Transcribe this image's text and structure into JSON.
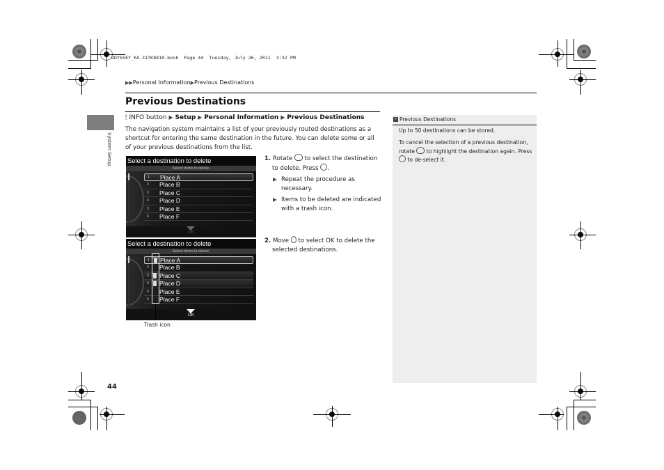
{
  "file_header": "ODYSSEY_KA-31TK8810.book  Page 44  Tuesday, July 26, 2011  3:32 PM",
  "breadcrumb": {
    "arrow": "▶▶",
    "items": [
      "Personal Information",
      "Previous Destinations"
    ],
    "separator": "▶"
  },
  "side_tab": {
    "label": "System Setup"
  },
  "page_title": "Previous Destinations",
  "path": {
    "icon": "info-button-icon",
    "start": "INFO button",
    "separator": "▶",
    "steps": [
      "Setup",
      "Personal Information",
      "Previous Destinations"
    ]
  },
  "intro": "The navigation system maintains a list of your previously routed destinations as a shortcut for entering the same destination in the future. You can delete some or all of your previous destinations from the list.",
  "screens": [
    {
      "title": "Select a destination to delete",
      "subtitle": "Select items to delete.",
      "ok_label": "OK",
      "rows": [
        {
          "num": "1",
          "label": "Place A",
          "selected": true,
          "trash": false
        },
        {
          "num": "2",
          "label": "Place B",
          "selected": false,
          "trash": false
        },
        {
          "num": "3",
          "label": "Place C",
          "selected": false,
          "trash": false
        },
        {
          "num": "4",
          "label": "Place D",
          "selected": false,
          "trash": false
        },
        {
          "num": "5",
          "label": "Place E",
          "selected": false,
          "trash": false
        },
        {
          "num": "6",
          "label": "Place F",
          "selected": false,
          "trash": false
        }
      ]
    },
    {
      "title": "Select a destination to delete",
      "subtitle": "Select items to delete.",
      "ok_label": "OK",
      "rows": [
        {
          "num": "1",
          "label": "Place A",
          "selected": true,
          "trash": true
        },
        {
          "num": "2",
          "label": "Place B",
          "selected": false,
          "trash": false
        },
        {
          "num": "3",
          "label": "Place C",
          "selected": false,
          "trash": true
        },
        {
          "num": "4",
          "label": "Place D",
          "selected": false,
          "trash": true
        },
        {
          "num": "5",
          "label": "Place E",
          "selected": false,
          "trash": false
        },
        {
          "num": "6",
          "label": "Place F",
          "selected": false,
          "trash": false
        }
      ]
    }
  ],
  "callout": {
    "label": "Trash icon"
  },
  "steps": [
    {
      "num": "1.",
      "text_a": "Rotate",
      "text_b": "to select the destination to delete. Press",
      "text_c": ".",
      "subs": [
        "Repeat the procedure as necessary.",
        "Items to be deleted are indicated with a trash icon."
      ]
    },
    {
      "num": "2.",
      "text_a": "Move",
      "text_b": "to select",
      "ok": "OK",
      "text_c": "to delete the selected destinations."
    }
  ],
  "sidebar": {
    "heading": "Previous Destinations",
    "heading_icon": "»",
    "note1": "Up to 50 destinations can be stored.",
    "note2_a": "To cancel the selection of a previous destination, rotate",
    "note2_b": "to highlight the destination again. Press",
    "note2_c": "to de-select it."
  },
  "page_number": "44"
}
